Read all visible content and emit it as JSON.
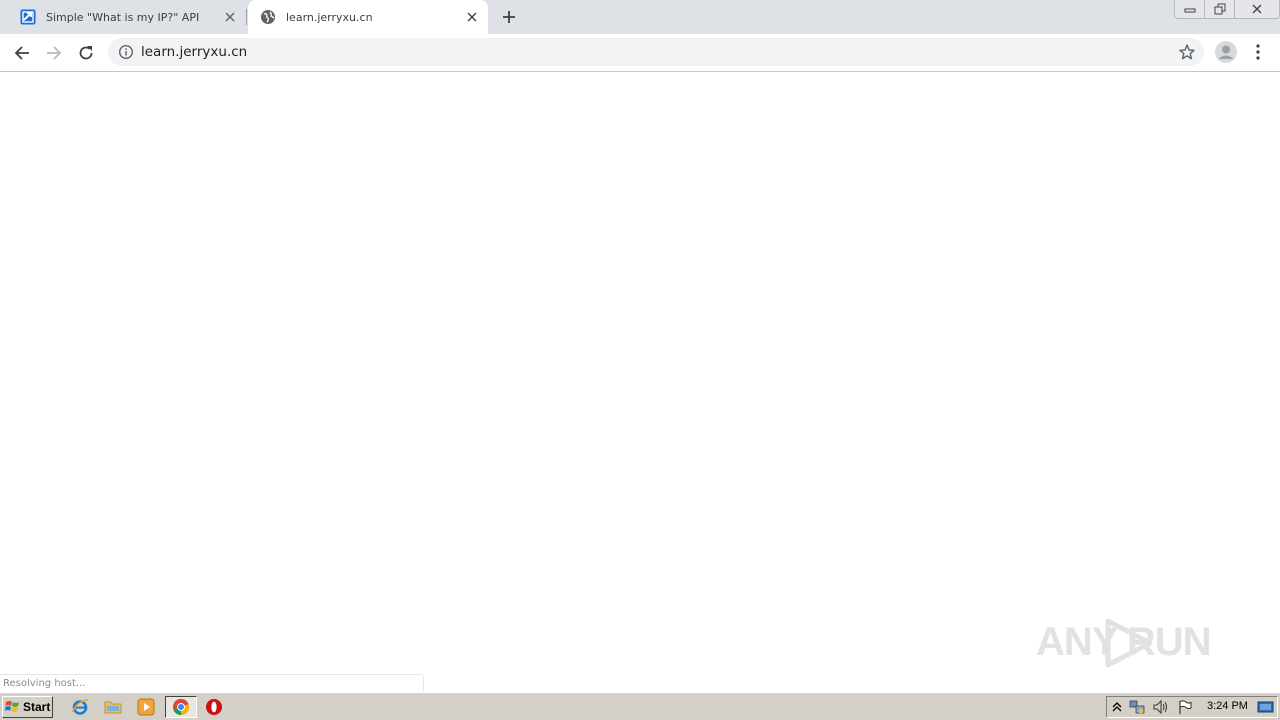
{
  "browser": {
    "tabs": [
      {
        "title": "Simple \"What is my IP?\" API",
        "favicon": "ipify-logo-icon",
        "active": false
      },
      {
        "title": "learn.jerryxu.cn",
        "favicon": "globe-icon",
        "active": true
      }
    ],
    "new_tab_icon": "plus-icon",
    "window_controls": [
      "minimize-icon",
      "restore-icon",
      "close-icon"
    ],
    "toolbar": {
      "back_icon": "arrow-left-icon",
      "forward_icon": "arrow-right-icon",
      "reload_icon": "reload-icon",
      "address": {
        "security_icon": "info-icon",
        "url": "learn.jerryxu.cn",
        "bookmark_icon": "star-icon"
      },
      "profile_icon": "avatar-icon",
      "menu_icon": "kebab-menu-icon"
    }
  },
  "content": {
    "status_text": "Resolving host...",
    "watermark_text": "ANY RUN"
  },
  "taskbar": {
    "start_label": "Start",
    "pinned": [
      "internet-explorer-icon",
      "folder-icon",
      "media-player-icon",
      "chrome-icon",
      "opera-icon"
    ],
    "tray_icons": [
      "chevron-up-icon",
      "network-icon",
      "volume-icon",
      "flag-icon",
      "show-desktop-icon"
    ],
    "clock": "3:24 PM"
  },
  "colors": {
    "tabstrip": "#dee1e6",
    "omnibox": "#f1f3f4",
    "taskbar": "#d4d0c8",
    "watermark": "#e2e2e2"
  }
}
